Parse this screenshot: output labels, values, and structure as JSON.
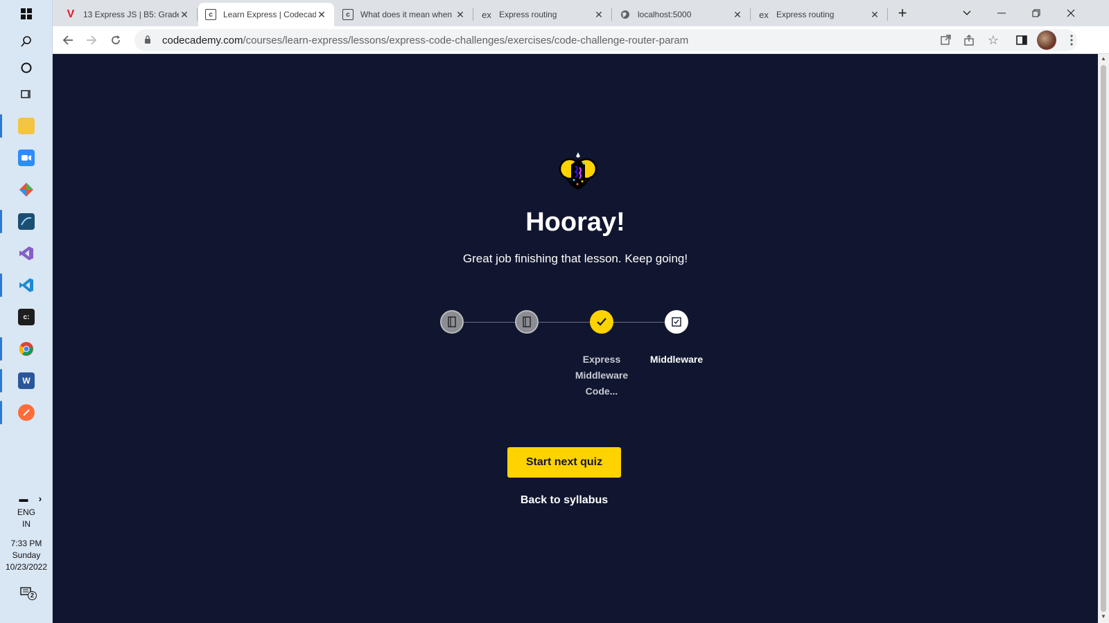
{
  "taskbar": {
    "lang": "ENG",
    "region": "IN",
    "time": "7:33 PM",
    "day": "Sunday",
    "date": "10/23/2022",
    "notification_count": "2"
  },
  "tabs": [
    {
      "title": "13 Express JS | B5: Grade",
      "favicon": "V",
      "color": "#e8132a"
    },
    {
      "title": "Learn Express | Codecade",
      "favicon": "c",
      "color": "#3c4043"
    },
    {
      "title": "What does it mean when",
      "favicon": "c",
      "color": "#3c4043"
    },
    {
      "title": "Express routing",
      "favicon": "ex",
      "color": "#3c4043"
    },
    {
      "title": "localhost:5000",
      "favicon": "globe",
      "color": "#5f6368"
    },
    {
      "title": "Express routing",
      "favicon": "ex",
      "color": "#3c4043"
    }
  ],
  "address": {
    "host": "codecademy.com",
    "path": "/courses/learn-express/lessons/express-code-challenges/exercises/code-challenge-router-param"
  },
  "main": {
    "heading": "Hooray!",
    "subheading": "Great job finishing that lesson. Keep going!",
    "steps": [
      {
        "status": "complete-grey",
        "label": ""
      },
      {
        "status": "complete-grey",
        "label": ""
      },
      {
        "status": "complete-yellow",
        "label": "Express Middleware Code..."
      },
      {
        "status": "current",
        "label": "Middleware"
      }
    ],
    "primary_button": "Start next quiz",
    "secondary_link": "Back to syllabus"
  },
  "colors": {
    "page_bg": "#10162f",
    "accent_yellow": "#ffd300"
  }
}
